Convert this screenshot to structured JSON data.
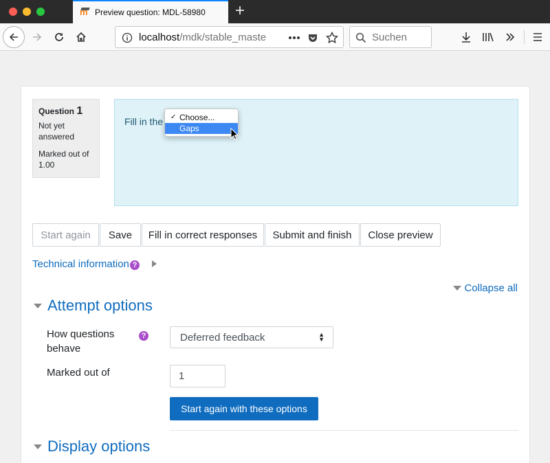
{
  "browser": {
    "tab_title": "Preview question: MDL-58980",
    "new_tab_symbol": "+",
    "url_host": "localhost",
    "url_path": "/mdk/stable_maste",
    "search_placeholder": "Suchen",
    "accent_color": "#0a84ff"
  },
  "question": {
    "label": "Question",
    "number": "1",
    "state": "Not yet answered",
    "marks": "Marked out of 1.00",
    "text": "Fill in the",
    "dropdown": {
      "options": [
        "Choose...",
        "Gaps"
      ],
      "checked": "Choose...",
      "highlighted": "Gaps"
    }
  },
  "actions": {
    "start_again": "Start again",
    "save": "Save",
    "fill_correct": "Fill in correct responses",
    "submit": "Submit and finish",
    "close": "Close preview"
  },
  "technical_info": "Technical information",
  "collapse_all": "Collapse all",
  "attempt_options": {
    "heading": "Attempt options",
    "behaviour_label": "How questions behave",
    "behaviour_value": "Deferred feedback",
    "marks_label": "Marked out of",
    "marks_value": "1",
    "submit": "Start again with these options"
  },
  "display_options": {
    "heading": "Display options"
  },
  "colors": {
    "link": "#0f6cbf",
    "help": "#a84ec9",
    "formulation_bg": "#def2f8"
  }
}
